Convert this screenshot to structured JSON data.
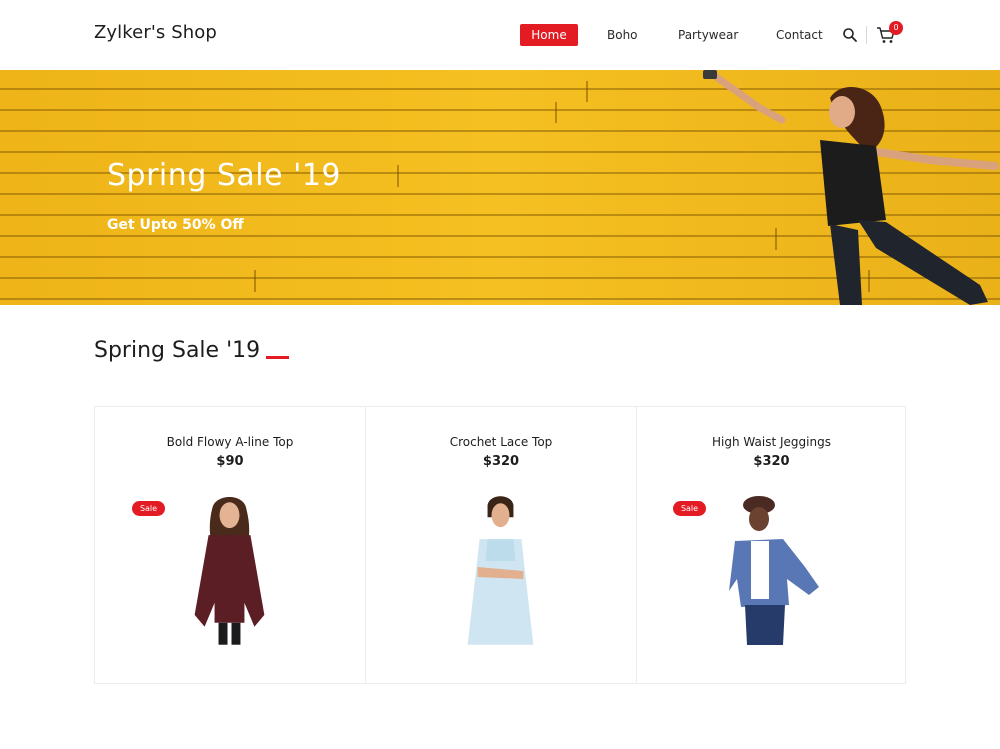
{
  "header": {
    "logo": "Zylker's Shop",
    "nav": [
      "Home",
      "Boho",
      "Partywear",
      "Contact"
    ],
    "active": "Home",
    "cart_count": "0",
    "icons": [
      "search-icon",
      "cart-icon"
    ]
  },
  "banner": {
    "title": "Spring Sale '19",
    "subtitle": "Get Upto 50% Off"
  },
  "section": {
    "title": "Spring Sale '19"
  },
  "products": [
    {
      "name": "Bold Flowy A-line Top",
      "price": "$90",
      "badge": "Sale"
    },
    {
      "name": "Crochet Lace Top",
      "price": "$320",
      "badge": ""
    },
    {
      "name": "High Waist Jeggings",
      "price": "$320",
      "badge": "Sale"
    }
  ],
  "colors": {
    "accent": "#e31b23",
    "banner_yellow": "#f2b71d",
    "text": "#1d1d1d"
  }
}
